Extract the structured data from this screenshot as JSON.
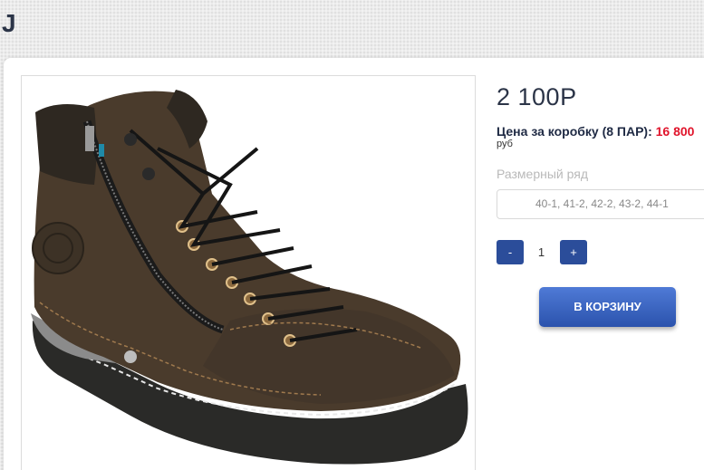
{
  "header": {
    "title": "J"
  },
  "product": {
    "image_alt": "brown nubuck lace-up boot with side zipper",
    "price": "2 100Р",
    "box_price_label": "Цена за коробку (8 ПАР):",
    "box_price_value": "16 800",
    "currency": "руб",
    "size_label": "Размерный ряд",
    "size_value": "40-1, 41-2, 42-2, 43-2, 44-1",
    "quantity": "1",
    "minus_label": "-",
    "plus_label": "+",
    "cart_label": "В КОРЗИНУ"
  },
  "colors": {
    "accent_blue": "#2b4d9a",
    "price_red": "#e0142b",
    "title_navy": "#2b3447"
  }
}
